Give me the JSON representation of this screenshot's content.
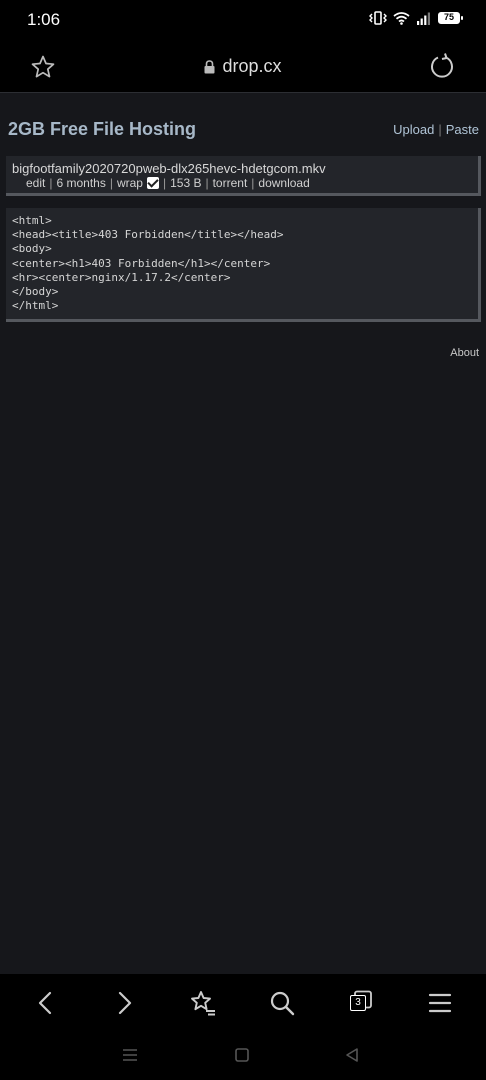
{
  "status_bar": {
    "time": "1:06",
    "battery_level": "75",
    "icons": [
      "vibrate-icon",
      "wifi-icon",
      "signal-icon",
      "battery-icon"
    ]
  },
  "address_bar": {
    "url": "drop.cx",
    "icons": [
      "star-icon",
      "lock-icon",
      "reload-icon"
    ]
  },
  "page": {
    "site_title": "2GB Free File Hosting",
    "links": {
      "upload": "Upload",
      "separator": "|",
      "paste": "Paste"
    },
    "file": {
      "name": "bigfootfamily2020720pweb-dlx265hevc-hdetgcom.mkv",
      "meta": {
        "edit": "edit",
        "expiry": "6 months",
        "wrap": "wrap",
        "wrap_checked": true,
        "size": "153 B",
        "torrent": "torrent",
        "download": "download",
        "separator": "|"
      }
    },
    "code": "<html>\n<head><title>403 Forbidden</title></head>\n<body>\n<center><h1>403 Forbidden</h1></center>\n<hr><center>nginx/1.17.2</center>\n</body>\n</html>",
    "about": "About"
  },
  "toolbar": {
    "tabs_count": "3",
    "icons": [
      "back-icon",
      "forward-icon",
      "bookmarks-icon",
      "search-icon",
      "tabs-icon",
      "menu-icon"
    ]
  },
  "navbar": {
    "icons": [
      "recents-icon",
      "home-icon",
      "back-nav-icon"
    ]
  }
}
